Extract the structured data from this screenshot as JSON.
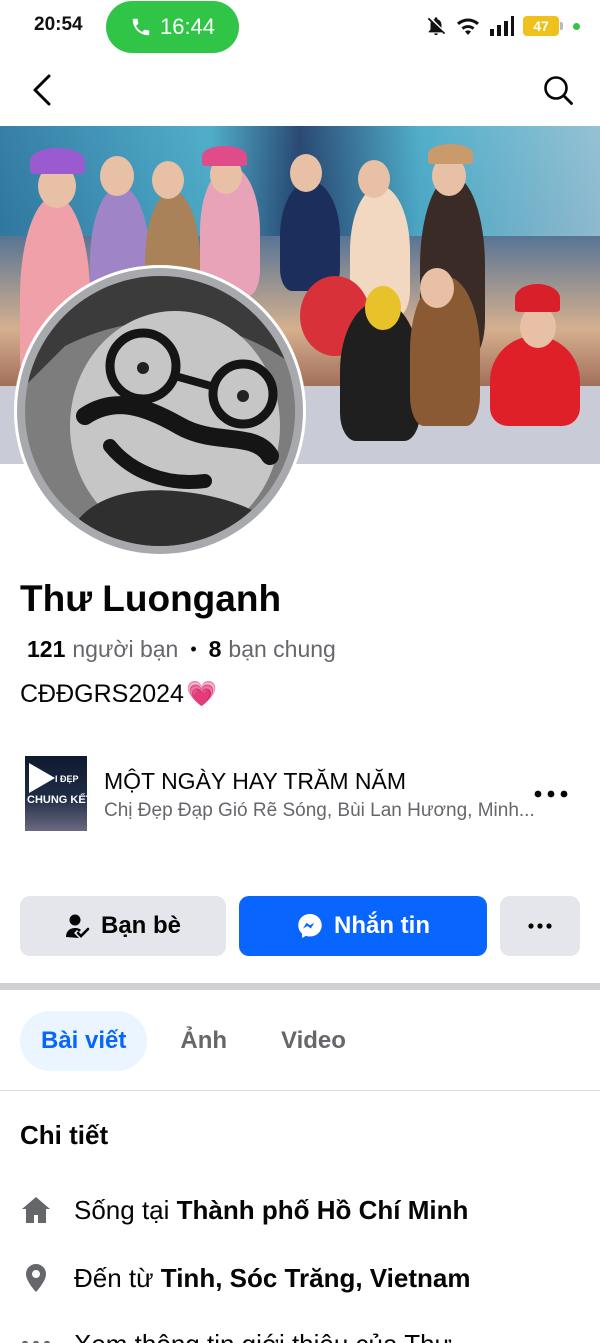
{
  "status_bar": {
    "time": "20:54",
    "call_timer": "16:44",
    "battery": "47"
  },
  "profile": {
    "name": "Thư Luonganh",
    "friends_count": "121",
    "friends_label": "người bạn",
    "mutual_count": "8",
    "mutual_label": "bạn chung",
    "bio": "CĐĐGRS2024",
    "bio_emoji": "💗"
  },
  "music": {
    "album_line1": "I ĐẸP",
    "album_line2": "CHUNG KẾT",
    "title": "MỘT NGÀY HAY TRĂM NĂM",
    "artist": "Chị Đẹp Đạp Gió Rẽ Sóng, Bùi Lan Hương, Minh..."
  },
  "actions": {
    "friends_label": "Bạn bè",
    "message_label": "Nhắn tin"
  },
  "tabs": [
    {
      "label": "Bài viết",
      "active": true
    },
    {
      "label": "Ảnh",
      "active": false
    },
    {
      "label": "Video",
      "active": false
    }
  ],
  "details": {
    "title": "Chi tiết",
    "lives_prefix": "Sống tại",
    "lives_value": "Thành phố Hồ Chí Minh",
    "from_prefix": "Đến từ",
    "from_value": "Tinh, Sóc Trăng, Vietnam",
    "intro_text": "Xem thông tin giới thiệu của Thư"
  },
  "colors": {
    "accent": "#0866ff",
    "call_green": "#31c548",
    "battery": "#f0c11d"
  }
}
